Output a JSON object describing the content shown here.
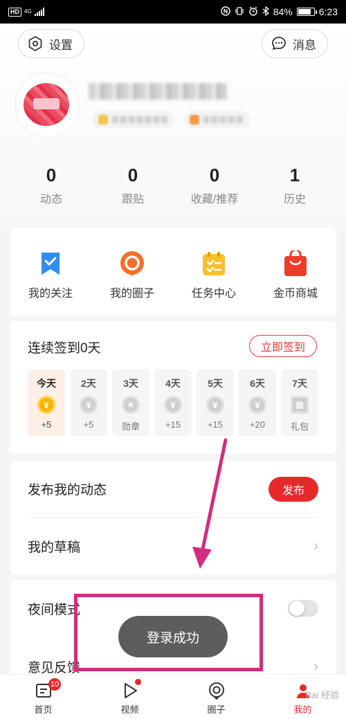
{
  "status_bar": {
    "hd": "HD",
    "network": "4G",
    "battery": "84%",
    "time": "6:23"
  },
  "header": {
    "settings_label": "设置",
    "messages_label": "消息"
  },
  "stats": [
    {
      "value": "0",
      "label": "动态"
    },
    {
      "value": "0",
      "label": "跟贴"
    },
    {
      "value": "0",
      "label": "收藏/推荐"
    },
    {
      "value": "1",
      "label": "历史"
    }
  ],
  "quick_links": [
    {
      "label": "我的关注",
      "icon": "bookmark-icon"
    },
    {
      "label": "我的圈子",
      "icon": "circle-chat-icon"
    },
    {
      "label": "任务中心",
      "icon": "clipboard-icon"
    },
    {
      "label": "金币商城",
      "icon": "shopping-bag-icon"
    }
  ],
  "signin": {
    "title": "连续签到0天",
    "button": "立即签到",
    "days": [
      {
        "day": "今天",
        "reward": "+5",
        "icon": "coin-icon"
      },
      {
        "day": "2天",
        "reward": "+5",
        "icon": "coin-icon"
      },
      {
        "day": "3天",
        "reward": "勋章",
        "icon": "medal-icon"
      },
      {
        "day": "4天",
        "reward": "+15",
        "icon": "coin-icon"
      },
      {
        "day": "5天",
        "reward": "+15",
        "icon": "coin-icon"
      },
      {
        "day": "6天",
        "reward": "+20",
        "icon": "coin-icon"
      },
      {
        "day": "7天",
        "reward": "礼包",
        "icon": "gift-icon"
      }
    ]
  },
  "posts": {
    "publish_title": "发布我的动态",
    "publish_button": "发布",
    "drafts": "我的草稿"
  },
  "settings": {
    "night_mode": "夜间模式",
    "feedback": "意见反馈"
  },
  "toast": "登录成功",
  "bottom_nav": {
    "home": "首页",
    "home_badge": "10",
    "video": "视频",
    "circle": "圈子",
    "mine": "我的"
  },
  "watermark": "Bai 经验",
  "colors": {
    "accent": "#e62a2a",
    "annotation": "#d22d7d",
    "toast_bg": "#5d5d5d"
  }
}
